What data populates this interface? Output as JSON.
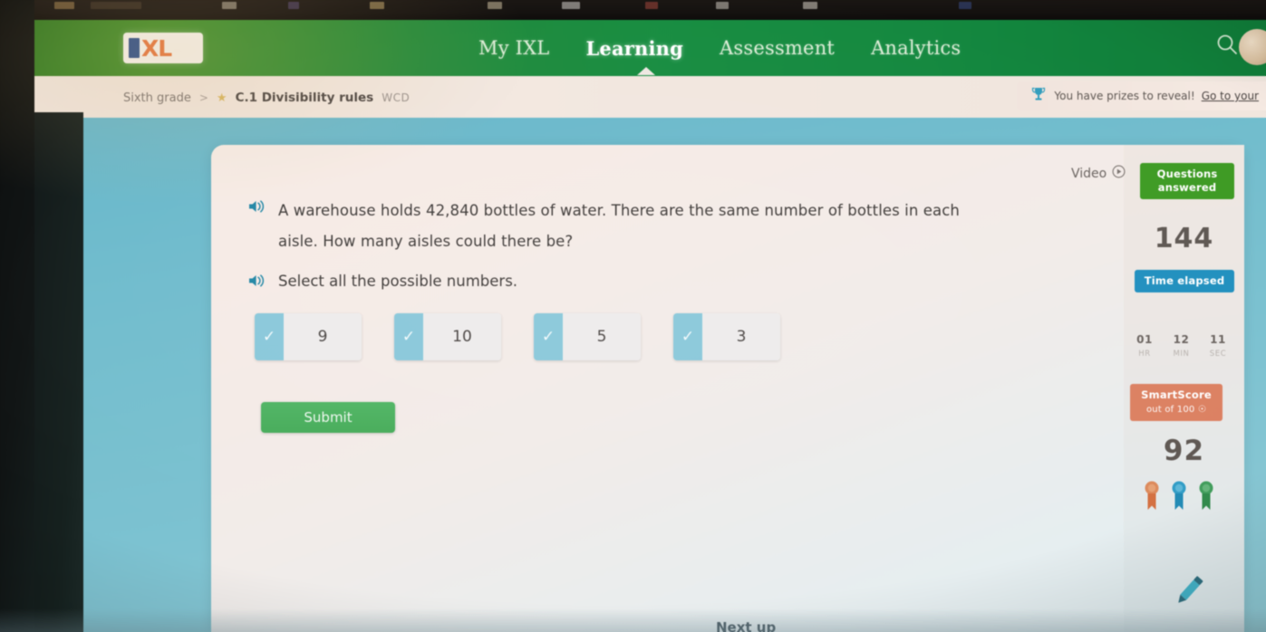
{
  "browser": {
    "chrome_visible": true
  },
  "header": {
    "logo_i": "I",
    "logo_xl": "XL",
    "nav": [
      {
        "label": "My IXL",
        "active": false
      },
      {
        "label": "Learning",
        "active": true
      },
      {
        "label": "Assessment",
        "active": false
      },
      {
        "label": "Analytics",
        "active": false
      }
    ],
    "search_icon": "search-icon",
    "avatar": "avatar"
  },
  "breadcrumb": {
    "grade": "Sixth grade",
    "separator": ">",
    "star": "★",
    "skill": "C.1 Divisibility rules",
    "code": "WCD"
  },
  "prize_banner": {
    "icon": "trophy-icon",
    "text": "You have prizes to reveal!",
    "link": "Go to your"
  },
  "video": {
    "label": "Video",
    "icon": "play-circle-icon"
  },
  "question": {
    "speaker_icon": "speaker-icon",
    "text": "A warehouse holds 42,840 bottles of water. There are the same number of bottles in each aisle. How many aisles could there be?",
    "instruction": "Select all the possible numbers.",
    "options": [
      {
        "value": "9",
        "checked": true
      },
      {
        "value": "10",
        "checked": true
      },
      {
        "value": "5",
        "checked": true
      },
      {
        "value": "3",
        "checked": true
      }
    ],
    "submit_label": "Submit"
  },
  "next_up": {
    "label": "Next up"
  },
  "stats": {
    "questions_label": "Questions answered",
    "questions_value": "144",
    "time_label": "Time elapsed",
    "time": [
      {
        "num": "01",
        "unit": "HR"
      },
      {
        "num": "12",
        "unit": "MIN"
      },
      {
        "num": "11",
        "unit": "SEC"
      }
    ],
    "smartscore_label": "SmartScore",
    "smartscore_sub": "out of 100",
    "smartscore_value": "92",
    "ribbons": [
      "bronze-ribbon",
      "blue-ribbon",
      "green-ribbon"
    ],
    "pencil_icon": "pencil-icon"
  },
  "colors": {
    "header_green": "#138f3f",
    "page_teal": "#79c3d2",
    "submit_green": "#43ad57",
    "checkbox_teal": "#87c9dc",
    "questions_green": "#3b9c1f",
    "time_blue": "#1c91c2",
    "smartscore_orange": "#e08060"
  }
}
